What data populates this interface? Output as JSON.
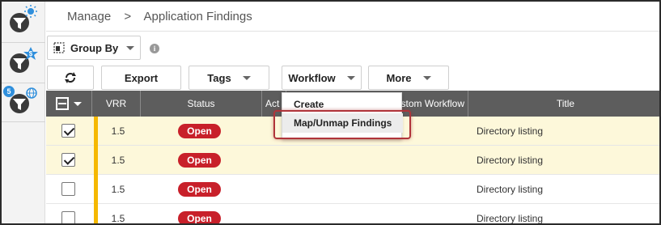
{
  "breadcrumb": {
    "root": "Manage",
    "separator": ">",
    "current": "Application Findings"
  },
  "rail": {
    "badge_count": "5",
    "icons": [
      "filter-sun-icon",
      "filter-dollar-icon",
      "filter-globe-icon"
    ]
  },
  "group_by": {
    "label": "Group By"
  },
  "toolbar": {
    "export_label": "Export",
    "tags_label": "Tags",
    "workflow_label": "Workflow",
    "more_label": "More"
  },
  "table": {
    "columns": {
      "vrr": "VRR",
      "status": "Status",
      "actions": "Act",
      "custom_workflow": "stom Workflow",
      "title": "Title"
    },
    "rows": [
      {
        "checked": true,
        "vrr": "1.5",
        "status": "Open",
        "title": "Directory listing"
      },
      {
        "checked": true,
        "vrr": "1.5",
        "status": "Open",
        "title": "Directory listing"
      },
      {
        "checked": false,
        "vrr": "1.5",
        "status": "Open",
        "title": "Directory listing"
      },
      {
        "checked": false,
        "vrr": "1.5",
        "status": "Open",
        "title": "Directory listing"
      }
    ]
  },
  "workflow_menu": {
    "items": [
      "Create",
      "Map/Unmap Findings"
    ],
    "highlighted": "Map/Unmap Findings"
  },
  "colors": {
    "header_bg": "#5d5d5d",
    "selected_row": "#fdf8da",
    "severity": "#f5b800",
    "open_badge": "#c8202a",
    "highlight_border": "#b0343a",
    "badge_blue": "#2f8fdc"
  }
}
